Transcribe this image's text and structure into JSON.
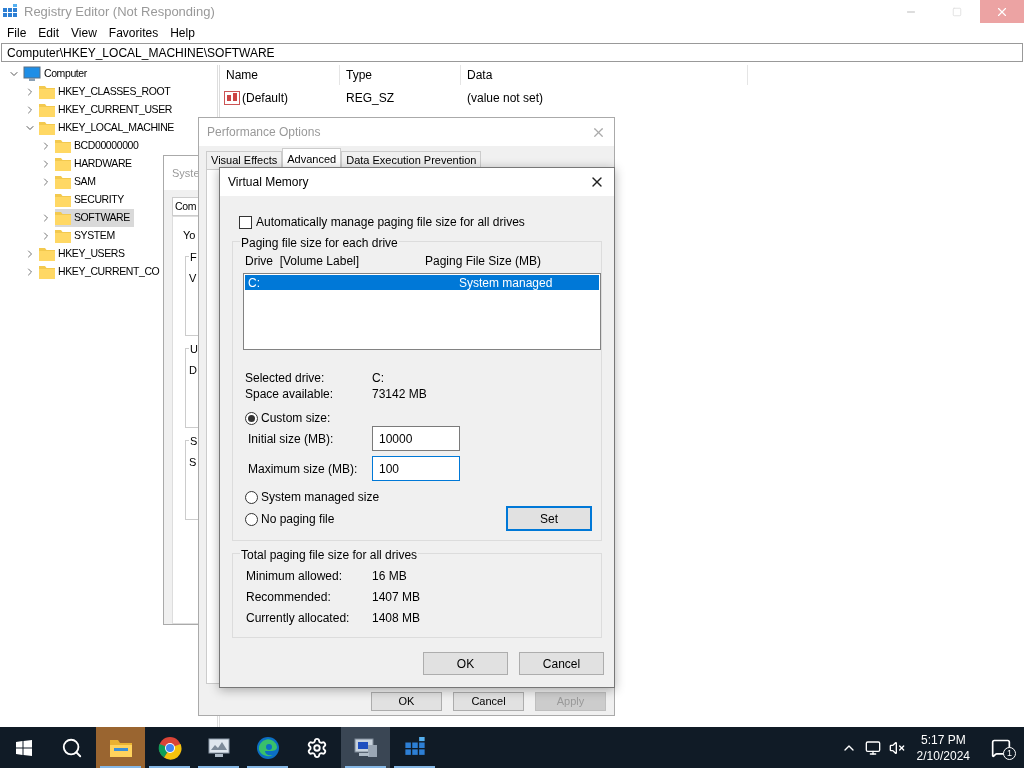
{
  "registry": {
    "title": "Registry Editor (Not Responding)",
    "menu": [
      "File",
      "Edit",
      "View",
      "Favorites",
      "Help"
    ],
    "address": "Computer\\HKEY_LOCAL_MACHINE\\SOFTWARE",
    "tree": [
      {
        "label": "Computer",
        "kind": "computer",
        "expandable": true,
        "expanded": true,
        "selected": false,
        "children": [
          {
            "label": "HKEY_CLASSES_ROOT",
            "kind": "folder",
            "expandable": true,
            "expanded": false,
            "selected": false
          },
          {
            "label": "HKEY_CURRENT_USER",
            "kind": "folder",
            "expandable": true,
            "expanded": false,
            "selected": false
          },
          {
            "label": "HKEY_LOCAL_MACHINE",
            "kind": "folder",
            "expandable": true,
            "expanded": true,
            "selected": false,
            "children": [
              {
                "label": "BCD00000000",
                "kind": "folder",
                "expandable": true,
                "expanded": false,
                "selected": false
              },
              {
                "label": "HARDWARE",
                "kind": "folder",
                "expandable": true,
                "expanded": false,
                "selected": false
              },
              {
                "label": "SAM",
                "kind": "folder",
                "expandable": true,
                "expanded": false,
                "selected": false
              },
              {
                "label": "SECURITY",
                "kind": "folder",
                "expandable": false,
                "selected": false
              },
              {
                "label": "SOFTWARE",
                "kind": "folder",
                "expandable": true,
                "expanded": false,
                "selected": true
              },
              {
                "label": "SYSTEM",
                "kind": "folder",
                "expandable": true,
                "expanded": false,
                "selected": false
              }
            ]
          },
          {
            "label": "HKEY_USERS",
            "kind": "folder",
            "expandable": true,
            "expanded": false,
            "selected": false
          },
          {
            "label": "HKEY_CURRENT_CO",
            "kind": "folder",
            "expandable": true,
            "expanded": false,
            "selected": false
          }
        ]
      }
    ],
    "columns": [
      "Name",
      "Type",
      "Data"
    ],
    "rows": [
      {
        "name": "(Default)",
        "type": "REG_SZ",
        "data": "(value not set)"
      }
    ]
  },
  "system_properties": {
    "title": "Syste",
    "tab": "Com",
    "text": "Yo",
    "groups": [
      {
        "legend": "F",
        "text": "V"
      },
      {
        "legend": "U",
        "text": "D"
      },
      {
        "legend": "S",
        "text": "S"
      }
    ]
  },
  "performance_options": {
    "title": "Performance Options",
    "tabs": [
      {
        "label": "Visual Effects",
        "selected": false
      },
      {
        "label": "Advanced",
        "selected": true
      },
      {
        "label": "Data Execution Prevention",
        "selected": false
      }
    ],
    "buttons": [
      {
        "label": "OK",
        "disabled": false
      },
      {
        "label": "Cancel",
        "disabled": false
      },
      {
        "label": "Apply",
        "disabled": true
      }
    ]
  },
  "virtual_memory": {
    "title": "Virtual Memory",
    "auto_manage": {
      "label": "Automatically manage paging file size for all drives",
      "checked": false
    },
    "paging_group": {
      "title": "Paging file size for each drive",
      "columns": [
        "Drive  [Volume Label]",
        "Paging File Size (MB)"
      ],
      "drives": [
        {
          "drive": "C:",
          "size": "System managed",
          "selected": true
        }
      ],
      "info": [
        {
          "label": "Selected drive:",
          "value": "C:"
        },
        {
          "label": "Space available:",
          "value": "73142 MB"
        }
      ],
      "options": [
        {
          "label": "Custom size:",
          "selected": true
        },
        {
          "label": "System managed size",
          "selected": false
        },
        {
          "label": "No paging file",
          "selected": false
        }
      ],
      "fields": [
        {
          "label": "Initial size (MB):",
          "value": "10000",
          "focused": false
        },
        {
          "label": "Maximum size (MB):",
          "value": "100",
          "focused": true
        }
      ],
      "set_button": "Set"
    },
    "totals": {
      "title": "Total paging file size for all drives",
      "rows": [
        {
          "label": "Minimum allowed:",
          "value": "16 MB"
        },
        {
          "label": "Recommended:",
          "value": "1407 MB"
        },
        {
          "label": "Currently allocated:",
          "value": "1408 MB"
        }
      ]
    },
    "buttons": [
      "OK",
      "Cancel"
    ]
  },
  "taskbar": {
    "apps": [
      {
        "kind": "file-explorer",
        "active": true,
        "running": true
      },
      {
        "kind": "chrome",
        "active": false,
        "running": true
      },
      {
        "kind": "monitor-app",
        "active": false,
        "running": true
      },
      {
        "kind": "edge",
        "active": false,
        "running": true
      },
      {
        "kind": "settings",
        "active": false,
        "running": false
      },
      {
        "kind": "system",
        "active": false,
        "running": true
      },
      {
        "kind": "registry",
        "active": false,
        "running": true
      }
    ],
    "time": "5:17 PM",
    "date": "2/10/2024",
    "notifications": "1"
  }
}
